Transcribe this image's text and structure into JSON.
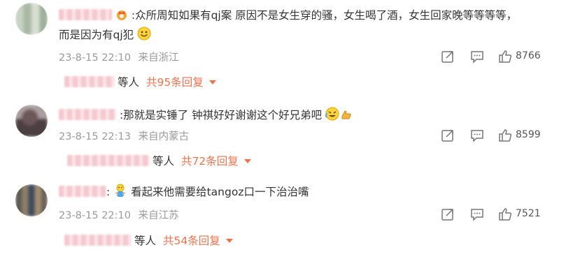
{
  "comments": [
    {
      "text_line1": ":众所周知如果有qj案 原因不是女生穿的骚，女生喝了酒，女生回家晚等等等等，",
      "text_line2": "而是因为有qj犯",
      "time": "23-8-15 22:10",
      "location": "来自浙江",
      "likes": "8766",
      "reply_suffix": "等人",
      "reply_total": "共95条回复",
      "emoji_inline": "crown-badge-icon",
      "emoji_end": "smile-emoji-icon"
    },
    {
      "text_line1": ":那就是实锤了 钟祺好好谢谢这个好兄弟吧",
      "time": "23-8-15 22:13",
      "location": "来自内蒙古",
      "likes": "8599",
      "reply_suffix": "等人",
      "reply_total": "共72条回复",
      "emoji_end": "laugh-cry-emoji-icon"
    },
    {
      "text_line1": "看起来他需要给tangoz口一下治治嘴",
      "time": "23-8-15 22:10",
      "location": "来自江苏",
      "likes": "7521",
      "reply_suffix": "等人",
      "reply_total": "共54条回复",
      "emoji_prefix": "hug-figure-emoji-icon"
    }
  ],
  "colors": {
    "accent": "#eb7350",
    "meta": "#9a9a9a",
    "text": "#333333"
  }
}
